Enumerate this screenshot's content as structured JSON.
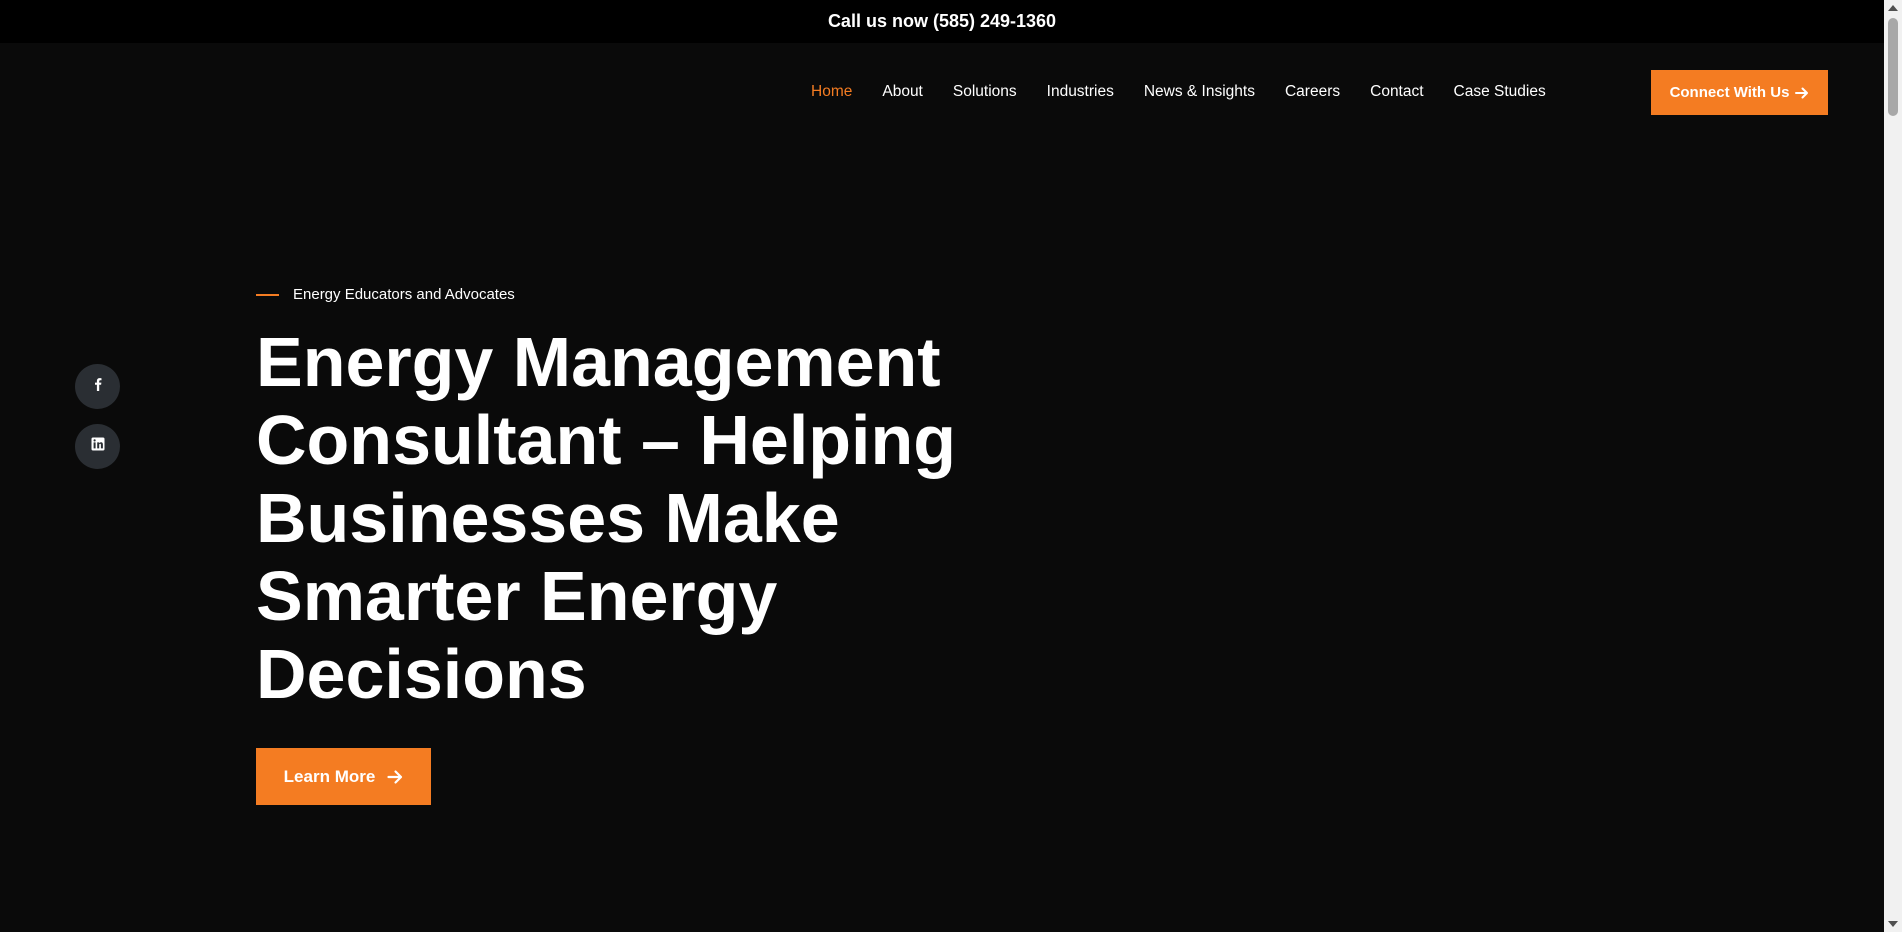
{
  "topbar": {
    "phone_text": "Call us now (585) 249-1360"
  },
  "nav": {
    "items": [
      {
        "label": "Home",
        "active": true
      },
      {
        "label": "About"
      },
      {
        "label": "Solutions"
      },
      {
        "label": "Industries"
      },
      {
        "label": "News & Insights"
      },
      {
        "label": "Careers"
      },
      {
        "label": "Contact"
      },
      {
        "label": "Case Studies"
      }
    ],
    "cta_label": "Connect With Us"
  },
  "hero": {
    "eyebrow": "Energy Educators and Advocates",
    "title": "Energy Management Consultant – Helping Businesses Make Smarter Energy Decisions",
    "button_label": "Learn More"
  },
  "social": {
    "icons": [
      "facebook-icon",
      "linkedin-icon"
    ]
  },
  "colors": {
    "accent": "#f47c22",
    "background": "#0a0a0a",
    "topbar": "#000000",
    "social_bg": "#2a2e33"
  }
}
